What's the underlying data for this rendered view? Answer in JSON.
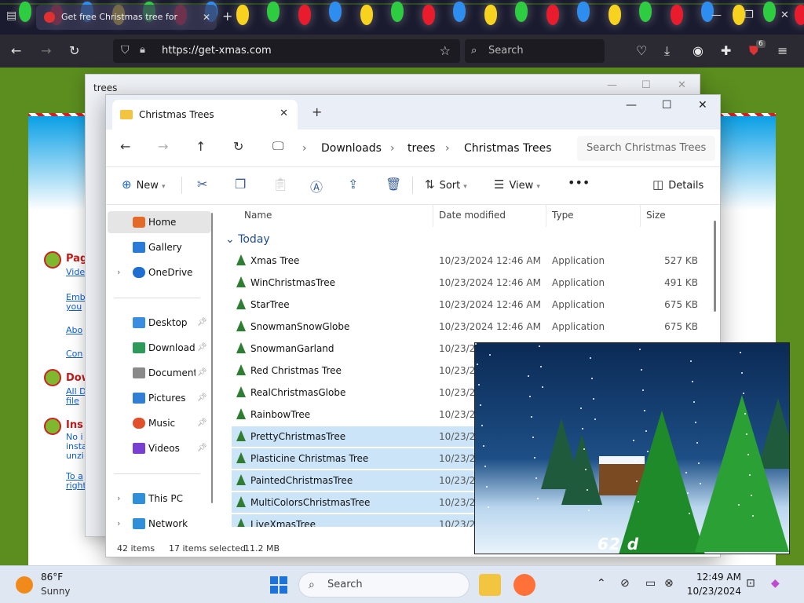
{
  "browser": {
    "tab_title": "Get free Christmas tree for",
    "url": "https://get-xmas.com",
    "search_placeholder": "Search",
    "extension_badge": "6"
  },
  "site": {
    "sections": [
      {
        "heading": "Pag",
        "links": [
          "Vide"
        ]
      },
      {
        "heading": "Dow",
        "links": [
          "All D",
          "file"
        ]
      },
      {
        "heading": "Ins",
        "lines": [
          "No i",
          "insta",
          "unzi"
        ]
      }
    ],
    "extra_links": [
      "Emb",
      "you",
      "Abo",
      "Con",
      "To a",
      "right"
    ]
  },
  "back_window": {
    "tab_title": "trees"
  },
  "explorer": {
    "tab_title": "Christmas Trees",
    "breadcrumb": [
      "Downloads",
      "trees",
      "Christmas Trees"
    ],
    "search_placeholder": "Search Christmas Trees",
    "commands": {
      "new": "New",
      "sort": "Sort",
      "view": "View",
      "details": "Details"
    },
    "nav": [
      {
        "label": "Home",
        "color": "#e46a2a"
      },
      {
        "label": "Gallery",
        "color": "#2a7bd8"
      },
      {
        "label": "OneDrive",
        "color": "#1e6fd0"
      },
      {
        "label": "Desktop",
        "color": "#3a8ee0"
      },
      {
        "label": "Download",
        "color": "#2e9a5a"
      },
      {
        "label": "Document",
        "color": "#8a8a8a"
      },
      {
        "label": "Pictures",
        "color": "#2f7fd4"
      },
      {
        "label": "Music",
        "color": "#e0502a"
      },
      {
        "label": "Videos",
        "color": "#7a3fd0"
      },
      {
        "label": "This PC",
        "color": "#2f8fd8"
      },
      {
        "label": "Network",
        "color": "#2f8fd8"
      }
    ],
    "columns": {
      "name": "Name",
      "date": "Date modified",
      "type": "Type",
      "size": "Size"
    },
    "group_label": "Today",
    "files": [
      {
        "name": "Xmas Tree",
        "date": "10/23/2024 12:46 AM",
        "type": "Application",
        "size": "527 KB"
      },
      {
        "name": "WinChristmasTree",
        "date": "10/23/2024 12:46 AM",
        "type": "Application",
        "size": "491 KB"
      },
      {
        "name": "StarTree",
        "date": "10/23/2024 12:46 AM",
        "type": "Application",
        "size": "675 KB"
      },
      {
        "name": "SnowmanSnowGlobe",
        "date": "10/23/2024 12:46 AM",
        "type": "Application",
        "size": "675 KB"
      },
      {
        "name": "SnowmanGarland",
        "date": "10/23/20",
        "type": "",
        "size": ""
      },
      {
        "name": "Red Christmas Tree",
        "date": "10/23/20",
        "type": "",
        "size": ""
      },
      {
        "name": "RealChristmasGlobe",
        "date": "10/23/20",
        "type": "",
        "size": ""
      },
      {
        "name": "RainbowTree",
        "date": "10/23/20",
        "type": "",
        "size": ""
      },
      {
        "name": "PrettyChristmasTree",
        "date": "10/23/20",
        "type": "",
        "size": "",
        "selected": true
      },
      {
        "name": "Plasticine Christmas Tree",
        "date": "10/23/20",
        "type": "",
        "size": "",
        "selected": true
      },
      {
        "name": "PaintedChristmasTree",
        "date": "10/23/20",
        "type": "",
        "size": "",
        "selected": true
      },
      {
        "name": "MultiColorsChristmasTree",
        "date": "10/23/20",
        "type": "",
        "size": "",
        "selected": true
      },
      {
        "name": "LiveXmasTree",
        "date": "10/23/20",
        "type": "",
        "size": "",
        "selected": true
      }
    ],
    "status": {
      "items": "42 items",
      "selected": "17 items selected",
      "size": "11.2 MB"
    }
  },
  "preview": {
    "counter": "62 d"
  },
  "taskbar": {
    "weather_temp": "86°F",
    "weather_cond": "Sunny",
    "search_label": "Search",
    "time": "12:49 AM",
    "date": "10/23/2024"
  },
  "colors": {
    "bulbs": [
      "#2ecc40",
      "#e81c2c",
      "#2e8ef0",
      "#f7d21e",
      "#2ecc40",
      "#e81c2c",
      "#2e8ef0",
      "#f7d21e"
    ],
    "selection": "#cce4f7",
    "accent": "#1e73d8"
  }
}
